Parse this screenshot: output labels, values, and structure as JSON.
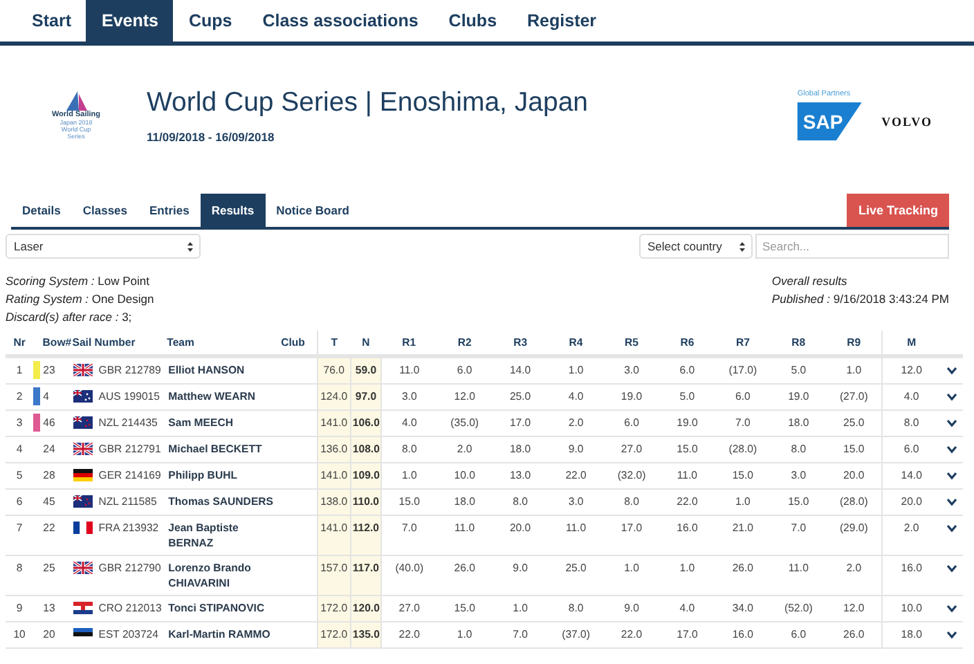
{
  "nav": {
    "items": [
      {
        "label": "Start",
        "selected": false
      },
      {
        "label": "Events",
        "selected": true
      },
      {
        "label": "Cups",
        "selected": false
      },
      {
        "label": "Class associations",
        "selected": false
      },
      {
        "label": "Clubs",
        "selected": false
      },
      {
        "label": "Register",
        "selected": false
      }
    ]
  },
  "header": {
    "logo": {
      "name": "World Sailing",
      "lines": [
        "Japan 2018",
        "World Cup",
        "Series"
      ]
    },
    "title": "World Cup Series | Enoshima, Japan",
    "dates": "11/09/2018 - 16/09/2018",
    "partners": {
      "label": "Global Partners",
      "sponsors": [
        "SAP",
        "VOLVO"
      ]
    }
  },
  "subtabs": {
    "items": [
      {
        "label": "Details",
        "selected": false
      },
      {
        "label": "Classes",
        "selected": false
      },
      {
        "label": "Entries",
        "selected": false
      },
      {
        "label": "Results",
        "selected": true
      },
      {
        "label": "Notice Board",
        "selected": false
      }
    ],
    "action": "Live Tracking"
  },
  "filters": {
    "class_select": "Laser",
    "country_select": "Select country",
    "search": {
      "placeholder": "Search..."
    }
  },
  "info": {
    "left": [
      "*Scoring System :* Low Point",
      "*Rating System :* One Design",
      "*Discard(s) after race :* 3;"
    ],
    "right_title": "Overall results",
    "published": "*Published :* 9/16/2018 3:43:24 PM"
  },
  "table": {
    "columns": [
      "Nr",
      "Bow#",
      "Sail Number",
      "Team",
      "Club",
      "T",
      "N",
      "R1",
      "R2",
      "R3",
      "R4",
      "R5",
      "R6",
      "R7",
      "R8",
      "R9",
      "M"
    ],
    "rows": [
      {
        "nr": "1",
        "color": "#f3ec4a",
        "bow": "23",
        "flag": {
          "kind": "gbr"
        },
        "sail": "GBR 212789",
        "team": "Elliot HANSON",
        "t": "76.0",
        "n": "59.0",
        "races": [
          "11.0",
          "6.0",
          "14.0",
          "1.0",
          "3.0",
          "6.0",
          "(17.0)",
          "5.0",
          "1.0"
        ],
        "m": "12.0"
      },
      {
        "nr": "2",
        "color": "#3d78c9",
        "bow": "4",
        "flag": {
          "kind": "aus"
        },
        "sail": "AUS 199015",
        "team": "Matthew WEARN",
        "t": "124.0",
        "n": "97.0",
        "races": [
          "3.0",
          "12.0",
          "25.0",
          "4.0",
          "19.0",
          "5.0",
          "6.0",
          "19.0",
          "(27.0)"
        ],
        "m": "4.0"
      },
      {
        "nr": "3",
        "color": "#df5a92",
        "bow": "46",
        "flag": {
          "kind": "nzl"
        },
        "sail": "NZL 214435",
        "team": "Sam MEECH",
        "t": "141.0",
        "n": "106.0",
        "races": [
          "4.0",
          "(35.0)",
          "17.0",
          "2.0",
          "6.0",
          "19.0",
          "7.0",
          "18.0",
          "25.0"
        ],
        "m": "8.0"
      },
      {
        "nr": "4",
        "bow": "24",
        "flag": {
          "kind": "gbr"
        },
        "sail": "GBR 212791",
        "team": "Michael BECKETT",
        "t": "136.0",
        "n": "108.0",
        "races": [
          "8.0",
          "2.0",
          "18.0",
          "9.0",
          "27.0",
          "15.0",
          "(28.0)",
          "8.0",
          "15.0"
        ],
        "m": "6.0"
      },
      {
        "nr": "5",
        "bow": "28",
        "flag": {
          "kind": "ger"
        },
        "sail": "GER 214169",
        "team": "Philipp BUHL",
        "t": "141.0",
        "n": "109.0",
        "races": [
          "1.0",
          "10.0",
          "13.0",
          "22.0",
          "(32.0)",
          "11.0",
          "15.0",
          "3.0",
          "20.0"
        ],
        "m": "14.0"
      },
      {
        "nr": "6",
        "bow": "45",
        "flag": {
          "kind": "nzl"
        },
        "sail": "NZL 211585",
        "team": "Thomas SAUNDERS",
        "t": "138.0",
        "n": "110.0",
        "races": [
          "15.0",
          "18.0",
          "8.0",
          "3.0",
          "8.0",
          "22.0",
          "1.0",
          "15.0",
          "(28.0)"
        ],
        "m": "20.0"
      },
      {
        "nr": "7",
        "bow": "22",
        "flag": {
          "kind": "fra"
        },
        "sail": "FRA 213932",
        "team": "Jean Baptiste BERNAZ",
        "t": "141.0",
        "n": "112.0",
        "races": [
          "7.0",
          "11.0",
          "20.0",
          "11.0",
          "17.0",
          "16.0",
          "21.0",
          "7.0",
          "(29.0)"
        ],
        "m": "2.0"
      },
      {
        "nr": "8",
        "bow": "25",
        "flag": {
          "kind": "gbr"
        },
        "sail": "GBR 212790",
        "team": "Lorenzo Brando CHIAVARINI",
        "t": "157.0",
        "n": "117.0",
        "races": [
          "(40.0)",
          "26.0",
          "9.0",
          "25.0",
          "1.0",
          "1.0",
          "26.0",
          "11.0",
          "2.0"
        ],
        "m": "16.0"
      },
      {
        "nr": "9",
        "bow": "13",
        "flag": {
          "kind": "cro"
        },
        "sail": "CRO 212013",
        "team": "Tonci STIPANOVIC",
        "t": "172.0",
        "n": "120.0",
        "races": [
          "27.0",
          "15.0",
          "1.0",
          "8.0",
          "9.0",
          "4.0",
          "34.0",
          "(52.0)",
          "12.0"
        ],
        "m": "10.0"
      },
      {
        "nr": "10",
        "bow": "20",
        "flag": {
          "kind": "est"
        },
        "sail": "EST 203724",
        "team": "Karl-Martin RAMMO",
        "t": "172.0",
        "n": "135.0",
        "races": [
          "22.0",
          "1.0",
          "7.0",
          "(37.0)",
          "22.0",
          "17.0",
          "16.0",
          "6.0",
          "26.0"
        ],
        "m": "18.0"
      }
    ]
  }
}
